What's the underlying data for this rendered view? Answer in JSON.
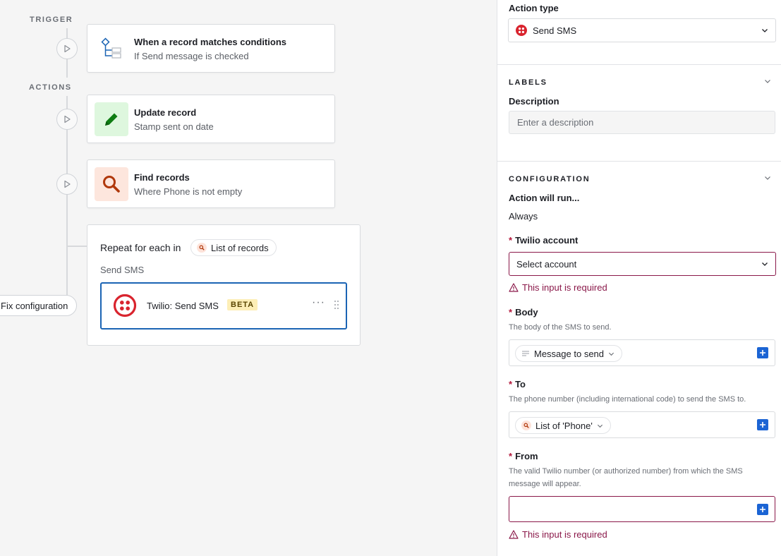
{
  "canvas": {
    "trigger_label": "TRIGGER",
    "actions_label": "ACTIONS",
    "trigger_card": {
      "title": "When a record matches conditions",
      "subtitle": "If Send message is checked"
    },
    "update_card": {
      "title": "Update record",
      "subtitle": "Stamp sent on date"
    },
    "find_card": {
      "title": "Find records",
      "subtitle": "Where Phone is not empty"
    },
    "repeat": {
      "title": "Repeat for each in",
      "pill_label": "List of records",
      "subtitle": "Send SMS",
      "inner": {
        "title": "Twilio: Send SMS",
        "badge": "BETA",
        "more": "···"
      }
    },
    "fix_button": "Fix configuration"
  },
  "panel": {
    "action_type": {
      "label": "Action type",
      "value": "Send SMS"
    },
    "labels": {
      "heading": "LABELS",
      "description_label": "Description",
      "description_placeholder": "Enter a description"
    },
    "configuration": {
      "heading": "CONFIGURATION",
      "run_label": "Action will run...",
      "run_value": "Always",
      "twilio_account": {
        "label": "Twilio account",
        "placeholder": "Select account",
        "error": "This input is required"
      },
      "body": {
        "label": "Body",
        "help": "The body of the SMS to send.",
        "token": "Message to send"
      },
      "to": {
        "label": "To",
        "help": "The phone number (including international code) to send the SMS to.",
        "token": "List of 'Phone'"
      },
      "from": {
        "label": "From",
        "help": "The valid Twilio number (or authorized number) from which the SMS message will appear.",
        "error": "This input is required"
      }
    },
    "required_mark": "*"
  },
  "colors": {
    "accent_blue": "#1b64b4",
    "error": "#8a1849",
    "twilio_red": "#d9242e",
    "update_green": "#0e7c12",
    "find_orange": "#b0380b"
  }
}
